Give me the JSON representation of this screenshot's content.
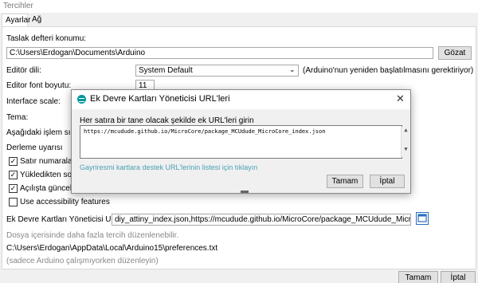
{
  "window": {
    "title": "Tercihler"
  },
  "tabs": [
    {
      "label": "Ayarlar"
    },
    {
      "label": "Ağ"
    }
  ],
  "settings": {
    "sketchbook_label": "Taslak defteri konumu:",
    "sketchbook_value": "C:\\Users\\Erdogan\\Documents\\Arduino",
    "browse_label": "Gözat",
    "editor_lang_label": "Editör dili:",
    "editor_lang_value": "System Default",
    "editor_lang_note": "(Arduino'nun yeniden başlatılmasını gerektiriyor)",
    "font_size_label": "Editor font boyutu:",
    "font_size_value": "11",
    "interface_scale_label": "Interface scale:",
    "theme_label": "Tema:",
    "verbose_label": "Aşağıdaki işlem sırasınd",
    "warnings_label": "Derleme uyarısı",
    "line_numbers_label": "Satır numaralarını g",
    "verify_label": "Yükledikten sonra k",
    "check_updates_label": "Açılışta güncellemel",
    "accessibility_label": "Use accessibility features",
    "boards_url_label": "Ek Devre Kartları Yöneticisi URL'leri:",
    "boards_url_value": "diy_attiny_index.json,https://mcudude.github.io/MicroCore/package_MCUdude_MicroCore_index.json",
    "more_prefs_note": "Dosya içerisinde daha fazla tercih düzenlenebilir.",
    "prefs_path": "C:\\Users\\Erdogan\\AppData\\Local\\Arduino15\\preferences.txt",
    "edit_note": "(sadece Arduino çalışmıyorken düzenleyin)"
  },
  "dialog": {
    "title": "Ek Devre Kartları Yöneticisi URL'leri",
    "instruction": "Her satıra bir tane olacak şekilde ek URL'leri girin",
    "textarea_value": "https://mcudude.github.io/MicroCore/package_MCUdude_MicroCore_index.json",
    "link_text": "Gayriresmi kartlara destek URL'lerinin listesi için tıklayın",
    "ok_label": "Tamam",
    "cancel_label": "İptal"
  },
  "footer": {
    "ok_label": "Tamam",
    "cancel_label": "İptal"
  },
  "colors": {
    "arduino_teal": "#00979c",
    "link": "#4aa0b4"
  }
}
